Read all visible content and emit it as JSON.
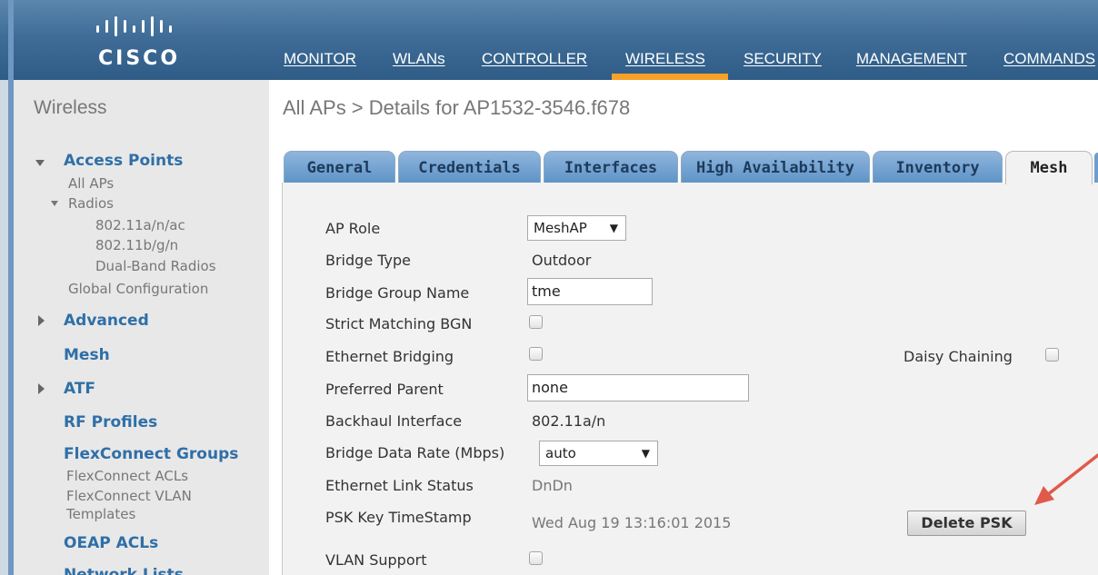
{
  "brand": {
    "logo_text": "CISCO"
  },
  "nav": {
    "items": [
      "MONITOR",
      "WLANs",
      "CONTROLLER",
      "WIRELESS",
      "SECURITY",
      "MANAGEMENT",
      "COMMANDS"
    ],
    "active": "WIRELESS",
    "accent_color": "#f7a12a"
  },
  "sidebar": {
    "title": "Wireless",
    "access_points": "Access Points",
    "all_aps": "All APs",
    "radios": "Radios",
    "radio_items": [
      "802.11a/n/ac",
      "802.11b/g/n",
      "Dual-Band Radios"
    ],
    "global_config": "Global Configuration",
    "advanced": "Advanced",
    "mesh": "Mesh",
    "atf": "ATF",
    "rf_profiles": "RF Profiles",
    "flexconnect_groups": "FlexConnect Groups",
    "flexconnect_acls": "FlexConnect ACLs",
    "flexconnect_vlan_1": "FlexConnect VLAN",
    "flexconnect_vlan_2": "Templates",
    "oeap_acls": "OEAP ACLs",
    "network_lists": "Network Lists"
  },
  "breadcrumb": "All APs > Details for AP1532-3546.f678",
  "tabs": [
    "General",
    "Credentials",
    "Interfaces",
    "High Availability",
    "Inventory",
    "Mesh"
  ],
  "active_tab": "Mesh",
  "form": {
    "ap_role": {
      "label": "AP Role",
      "value": "MeshAP"
    },
    "bridge_type": {
      "label": "Bridge Type",
      "value": "Outdoor"
    },
    "bridge_group_name": {
      "label": "Bridge Group Name",
      "value": "tme"
    },
    "strict_matching_bgn": {
      "label": "Strict Matching BGN"
    },
    "ethernet_bridging": {
      "label": "Ethernet Bridging"
    },
    "daisy_chaining": {
      "label": "Daisy Chaining"
    },
    "preferred_parent": {
      "label": "Preferred Parent",
      "value": "none"
    },
    "backhaul_interface": {
      "label": "Backhaul Interface",
      "value": "802.11a/n"
    },
    "bridge_data_rate": {
      "label": "Bridge Data Rate (Mbps)",
      "value": "auto"
    },
    "ethernet_link_status": {
      "label": "Ethernet Link Status",
      "value": "DnDn"
    },
    "psk_key_timestamp": {
      "label": "PSK Key TimeStamp",
      "value": "Wed Aug 19 13:16:01 2015"
    },
    "vlan_support": {
      "label": "VLAN Support"
    },
    "delete_psk_label": "Delete PSK"
  },
  "annotation": {
    "arrow_color": "#e05a4a"
  }
}
